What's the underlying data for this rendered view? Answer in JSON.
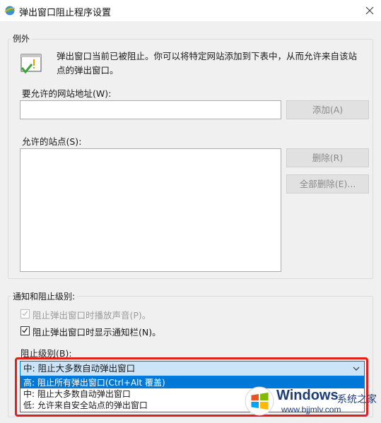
{
  "window": {
    "title": "弹出窗口阻止程序设置",
    "icon": "ie-globe-icon"
  },
  "exceptions": {
    "group_label": "例外",
    "info_icon": "warning-window-icon",
    "info_text_line1": "弹出窗口当前已被阻止。你可以将特定网站添加到下表中，从而允许来自该站",
    "info_text_line2": "点的弹出窗口。",
    "address_label": "要允许的网站地址(W):",
    "address_value": "",
    "add_button": "添加(A)",
    "allowed_sites_label": "允许的站点(S):",
    "allowed_sites": [],
    "remove_button": "删除(R)",
    "remove_all_button": "全部删除(E)..."
  },
  "notify": {
    "group_label": "通知和阻止级别:",
    "play_sound_label": "阻止弹出窗口时播放声音(P)。",
    "play_sound_checked": true,
    "show_bar_label": "阻止弹出窗口时显示通知栏(N)。",
    "show_bar_checked": true,
    "level_label": "阻止级别(B):",
    "level_selected": "中: 阻止大多数自动弹出窗口",
    "level_options": [
      "高: 阻止所有弹出窗口(Ctrl+Alt 覆盖)",
      "中: 阻止大多数自动弹出窗口",
      "低: 允许来自安全站点的弹出窗口"
    ],
    "highlighted_option_index": 0
  },
  "watermark": {
    "brand": "Windows",
    "subtitle": "系统之家",
    "url": "www.bjjmlv.com"
  },
  "colors": {
    "accent": "#0078d7",
    "highlight_frame": "#e0201e",
    "panel_bg": "#f0f0f0"
  }
}
